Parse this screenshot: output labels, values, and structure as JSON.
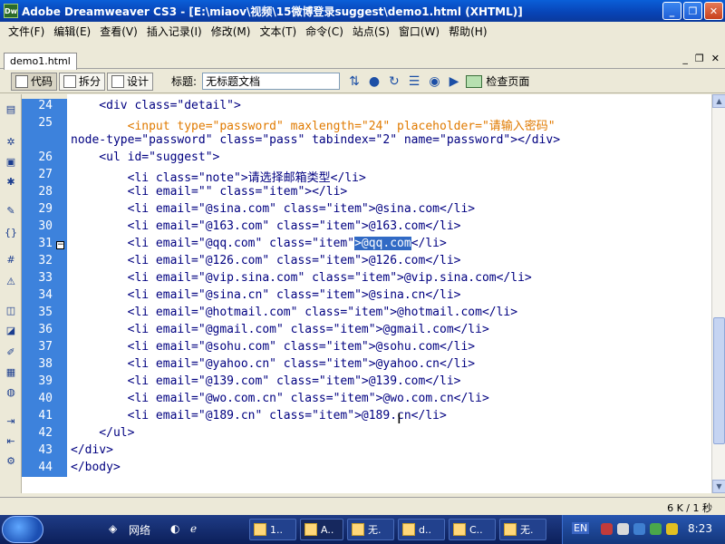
{
  "titlebar": {
    "app_badge": "Dw",
    "title": "Adobe Dreamweaver CS3 - [E:\\miaov\\视频\\15微博登录suggest\\demo1.html (XHTML)]",
    "minimize": "_",
    "restore": "❐",
    "close": "✕"
  },
  "menu": [
    "文件(F)",
    "编辑(E)",
    "查看(V)",
    "插入记录(I)",
    "修改(M)",
    "文本(T)",
    "命令(C)",
    "站点(S)",
    "窗口(W)",
    "帮助(H)"
  ],
  "document": {
    "tab_label": "demo1.html",
    "ctrl_minimize": "_",
    "ctrl_restore": "❐",
    "ctrl_close": "✕"
  },
  "toolbar": {
    "code_label": "代码",
    "split_label": "拆分",
    "design_label": "设计",
    "title_label": "标题:",
    "title_value": "无标题文档",
    "check_page_label": "检查页面"
  },
  "code": {
    "line_numbers": [
      "24",
      "25",
      "",
      "26",
      "27",
      "28",
      "29",
      "30",
      "31",
      "32",
      "33",
      "34",
      "35",
      "36",
      "37",
      "38",
      "39",
      "40",
      "41",
      "42",
      "43",
      "44"
    ],
    "lines": [
      {
        "text": "    <div class=\"detail\">",
        "style": "tag"
      },
      {
        "text": "        <input type=\"password\" maxlength=\"24\" placeholder=\"请输入密码\"",
        "style": "orange"
      },
      {
        "text": "node-type=\"password\" class=\"pass\" tabindex=\"2\" name=\"password\"></div>",
        "style": "tag"
      },
      {
        "text": "    <ul id=\"suggest\">",
        "style": "tag"
      },
      {
        "text": "        <li class=\"note\">请选择邮箱类型</li>",
        "style": "tag"
      },
      {
        "text": "        <li email=\"\" class=\"item\"></li>",
        "style": "tag"
      },
      {
        "text": "        <li email=\"@sina.com\" class=\"item\">@sina.com</li>",
        "style": "tag"
      },
      {
        "text": "        <li email=\"@163.com\" class=\"item\">@163.com</li>",
        "style": "tag"
      },
      {
        "text": "        <li email=\"@qq.com\" class=\"item\">@qq.com</li>",
        "style": "tag",
        "selected": ">@qq.com"
      },
      {
        "text": "        <li email=\"@126.com\" class=\"item\">@126.com</li>",
        "style": "tag"
      },
      {
        "text": "        <li email=\"@vip.sina.com\" class=\"item\">@vip.sina.com</li>",
        "style": "tag"
      },
      {
        "text": "        <li email=\"@sina.cn\" class=\"item\">@sina.cn</li>",
        "style": "tag"
      },
      {
        "text": "        <li email=\"@hotmail.com\" class=\"item\">@hotmail.com</li>",
        "style": "tag"
      },
      {
        "text": "        <li email=\"@gmail.com\" class=\"item\">@gmail.com</li>",
        "style": "tag"
      },
      {
        "text": "        <li email=\"@sohu.com\" class=\"item\">@sohu.com</li>",
        "style": "tag"
      },
      {
        "text": "        <li email=\"@yahoo.cn\" class=\"item\">@yahoo.cn</li>",
        "style": "tag"
      },
      {
        "text": "        <li email=\"@139.com\" class=\"item\">@139.com</li>",
        "style": "tag"
      },
      {
        "text": "        <li email=\"@wo.com.cn\" class=\"item\">@wo.com.cn</li>",
        "style": "tag"
      },
      {
        "text": "        <li email=\"@189.cn\" class=\"item\">@189.cn</li>",
        "style": "tag"
      },
      {
        "text": "    </ul>",
        "style": "tag"
      },
      {
        "text": "</div>",
        "style": "tag"
      },
      {
        "text": "</body>",
        "style": "tag"
      }
    ],
    "fold_marker": "−"
  },
  "status": {
    "text": "6 K / 1 秒"
  },
  "taskbar": {
    "network_label": "网络",
    "items": [
      "1..",
      "A..",
      "无.",
      "d..",
      "C..",
      "无."
    ],
    "lang": "EN",
    "clock": "8:23"
  },
  "colors": {
    "gutter": "#3d82dc",
    "tag_blue": "#000080",
    "attr_orange": "#e07a00",
    "selection": "#316ac5"
  }
}
